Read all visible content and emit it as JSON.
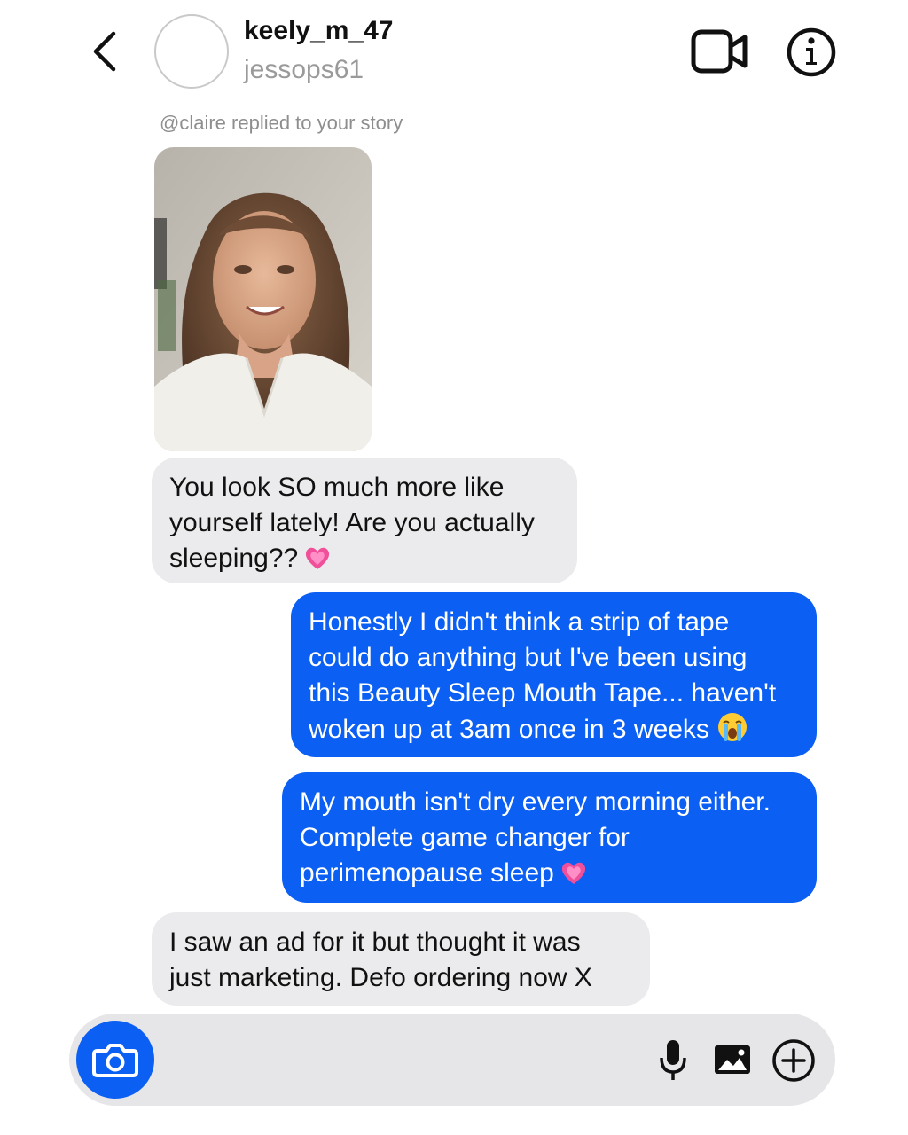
{
  "header": {
    "username": "keely_m_47",
    "handle": "jessops61"
  },
  "story": {
    "reply_note": "@claire replied to your story"
  },
  "messages": [
    {
      "direction": "incoming",
      "lines": [
        "You look SO much more like",
        "yourself lately! Are you actually",
        "sleeping??"
      ],
      "emoji": "pink-heart"
    },
    {
      "direction": "outgoing",
      "lines": [
        "Honestly I didn't think a strip of tape",
        "could do anything but I've been using",
        "this Beauty Sleep Mouth Tape... haven't",
        "woken up at 3am once in 3 weeks"
      ],
      "emoji": "crying-face"
    },
    {
      "direction": "outgoing",
      "lines": [
        "My mouth isn't dry every morning either.",
        "Complete game changer for",
        "perimenopause sleep"
      ],
      "emoji": "pink-heart"
    },
    {
      "direction": "incoming",
      "lines": [
        "I saw an ad for it but thought it was",
        "just marketing. Defo ordering now X"
      ]
    }
  ],
  "composer": {
    "placeholder": ""
  },
  "colors": {
    "outgoing_bubble": "#0b5ff2",
    "incoming_bubble": "#ebebed",
    "composer_bg": "#e6e6e8"
  }
}
